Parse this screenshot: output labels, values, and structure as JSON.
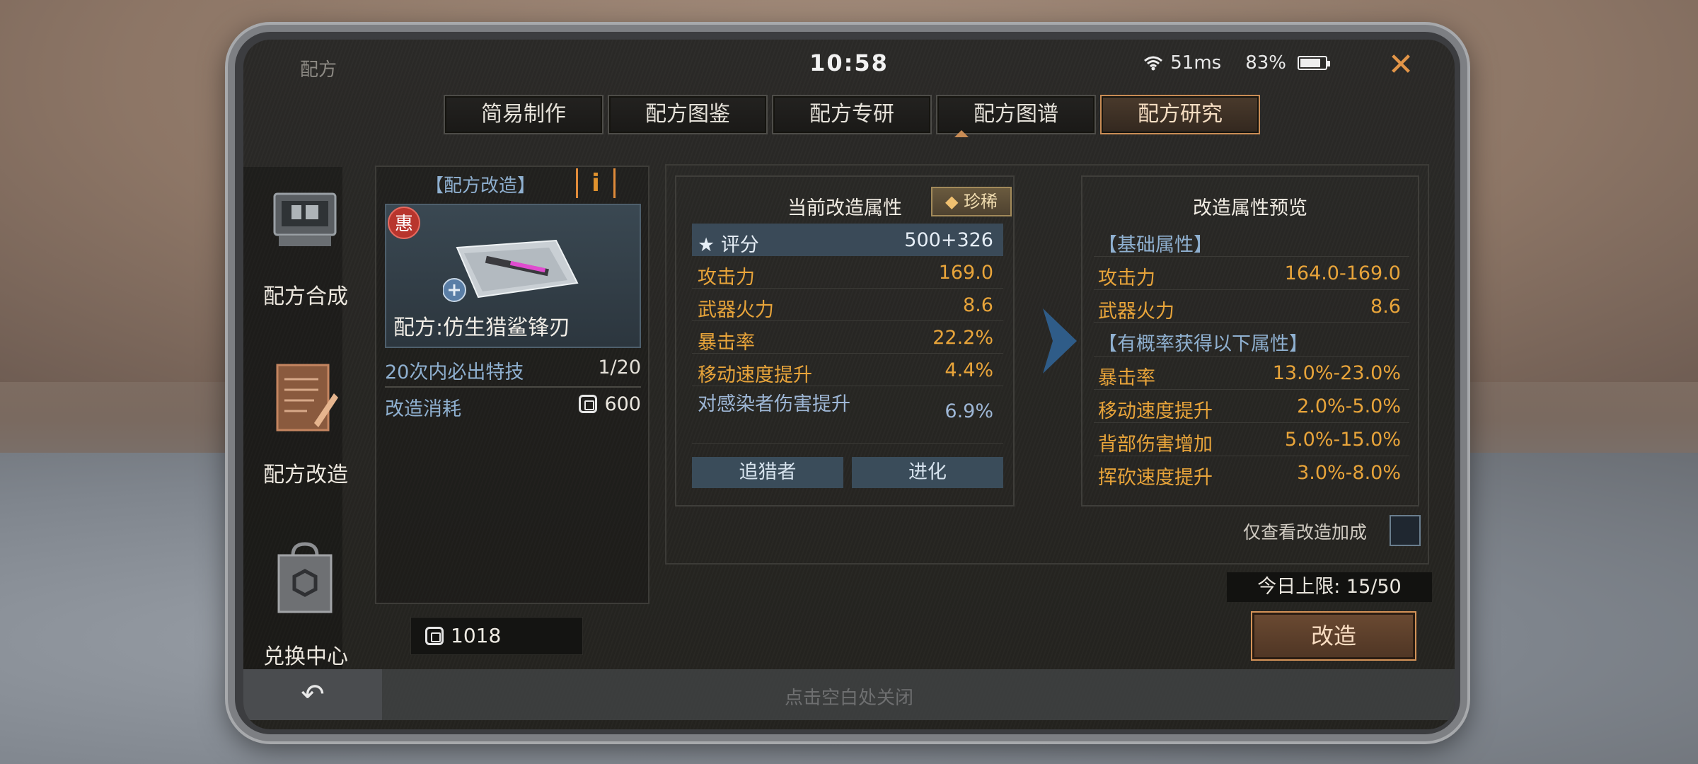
{
  "status": {
    "title": "配方",
    "time": "10:58",
    "ping": "51ms",
    "battery": "83%",
    "battery_level": 0.83
  },
  "tabs": [
    {
      "label": "简易制作"
    },
    {
      "label": "配方图鉴"
    },
    {
      "label": "配方专研"
    },
    {
      "label": "配方图谱"
    },
    {
      "label": "配方研究",
      "active": true
    }
  ],
  "sidenav": [
    {
      "label": "配方合成"
    },
    {
      "label": "配方改造"
    },
    {
      "label": "兑换中心"
    }
  ],
  "left_panel": {
    "title": "【配方改造】",
    "badge": "惠",
    "item_name": "配方:仿生猎鲨锋刃",
    "guarantee_label": "20次内必出特技",
    "guarantee_value": "1/20",
    "cost_label": "改造消耗",
    "cost_value": "600",
    "wallet": "1018"
  },
  "current": {
    "title": "当前改造属性",
    "rarity": "珍稀",
    "rows": [
      {
        "k": "评分",
        "v": "500+326"
      },
      {
        "k": "攻击力",
        "v": "169.0"
      },
      {
        "k": "武器火力",
        "v": "8.6"
      },
      {
        "k": "暴击率",
        "v": "22.2%"
      },
      {
        "k": "移动速度提升",
        "v": "4.4%"
      },
      {
        "k": "对感染者伤害提升",
        "v": "6.9%"
      }
    ],
    "tag1": "追猎者",
    "tag2": "进化"
  },
  "preview": {
    "title": "改造属性预览",
    "base_header": "【基础属性】",
    "base_rows": [
      {
        "k": "攻击力",
        "v": "164.0-169.0"
      },
      {
        "k": "武器火力",
        "v": "8.6"
      }
    ],
    "chance_header": "【有概率获得以下属性】",
    "chance_rows": [
      {
        "k": "暴击率",
        "v": "13.0%-23.0%"
      },
      {
        "k": "移动速度提升",
        "v": "2.0%-5.0%"
      },
      {
        "k": "背部伤害增加",
        "v": "5.0%-15.0%"
      },
      {
        "k": "挥砍速度提升",
        "v": "3.0%-8.0%"
      }
    ]
  },
  "checkbox_label": "仅查看改造加成",
  "daily_limit": "今日上限:  15/50",
  "modify_button": "改造",
  "dismiss_hint": "点击空白处关闭",
  "colors": {
    "accent_orange": "#e8a43a",
    "accent_blue": "#8fb0d0",
    "active_tab": "#c98c55"
  }
}
